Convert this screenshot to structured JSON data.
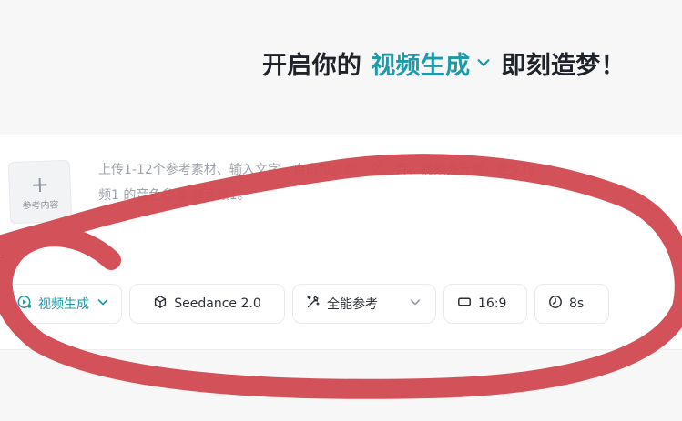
{
  "header": {
    "prefix": "开启你的",
    "mode": "视频生成",
    "suffix": "即刻造梦！"
  },
  "composer": {
    "reference_tile_label": "参考内容",
    "placeholder_line1": "上传1-12个参考素材、输入文字，自由组合图、文、音、视频多元素，定义精",
    "placeholder_line2": "频1 的音色参考 @音频1。"
  },
  "toolbar": {
    "mode_label": "视频生成",
    "model_label": "Seedance 2.0",
    "reference_label": "全能参考",
    "aspect_label": "16:9",
    "duration_label": "8s"
  },
  "colors": {
    "accent": "#1c9aa7",
    "annotation": "#d14a52"
  },
  "icons": {
    "mode": "video-generate-icon",
    "model": "cube-icon",
    "reference": "magic-wand-icon",
    "aspect": "aspect-ratio-icon",
    "duration": "clock-icon",
    "chevron": "chevron-down-icon"
  }
}
